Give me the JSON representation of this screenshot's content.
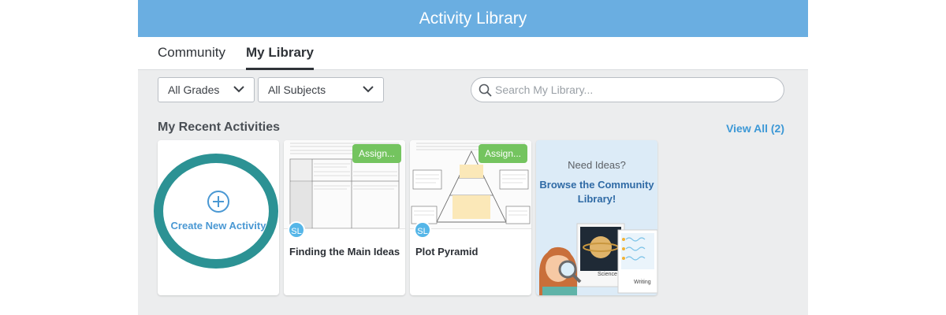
{
  "header": {
    "title": "Activity Library"
  },
  "tabs": [
    {
      "label": "Community",
      "active": false
    },
    {
      "label": "My Library",
      "active": true
    }
  ],
  "filters": {
    "grades": "All Grades",
    "subjects": "All Subjects"
  },
  "search": {
    "placeholder": "Search My Library..."
  },
  "recent": {
    "title": "My Recent Activities",
    "view_all": "View All (2)",
    "create_label": "Create New Activity",
    "cards": [
      {
        "title": "Finding the Main Ideas",
        "assign_label": "Assign...",
        "badge": "SL"
      },
      {
        "title": "Plot Pyramid",
        "assign_label": "Assign...",
        "badge": "SL"
      }
    ],
    "ideas": {
      "need": "Need Ideas?",
      "browse": "Browse the Community Library!",
      "science_caption": "Science",
      "writing_caption": "Writing"
    }
  },
  "colors": {
    "header": "#6aaee1",
    "accent_link": "#3c98d6",
    "assign_green": "#74c45f",
    "highlight_ring": "#2c9294",
    "badge_blue": "#55b6e8"
  },
  "icons": {
    "plus": "plus-circle-icon",
    "search": "search-icon",
    "chevron": "chevron-down-icon"
  }
}
